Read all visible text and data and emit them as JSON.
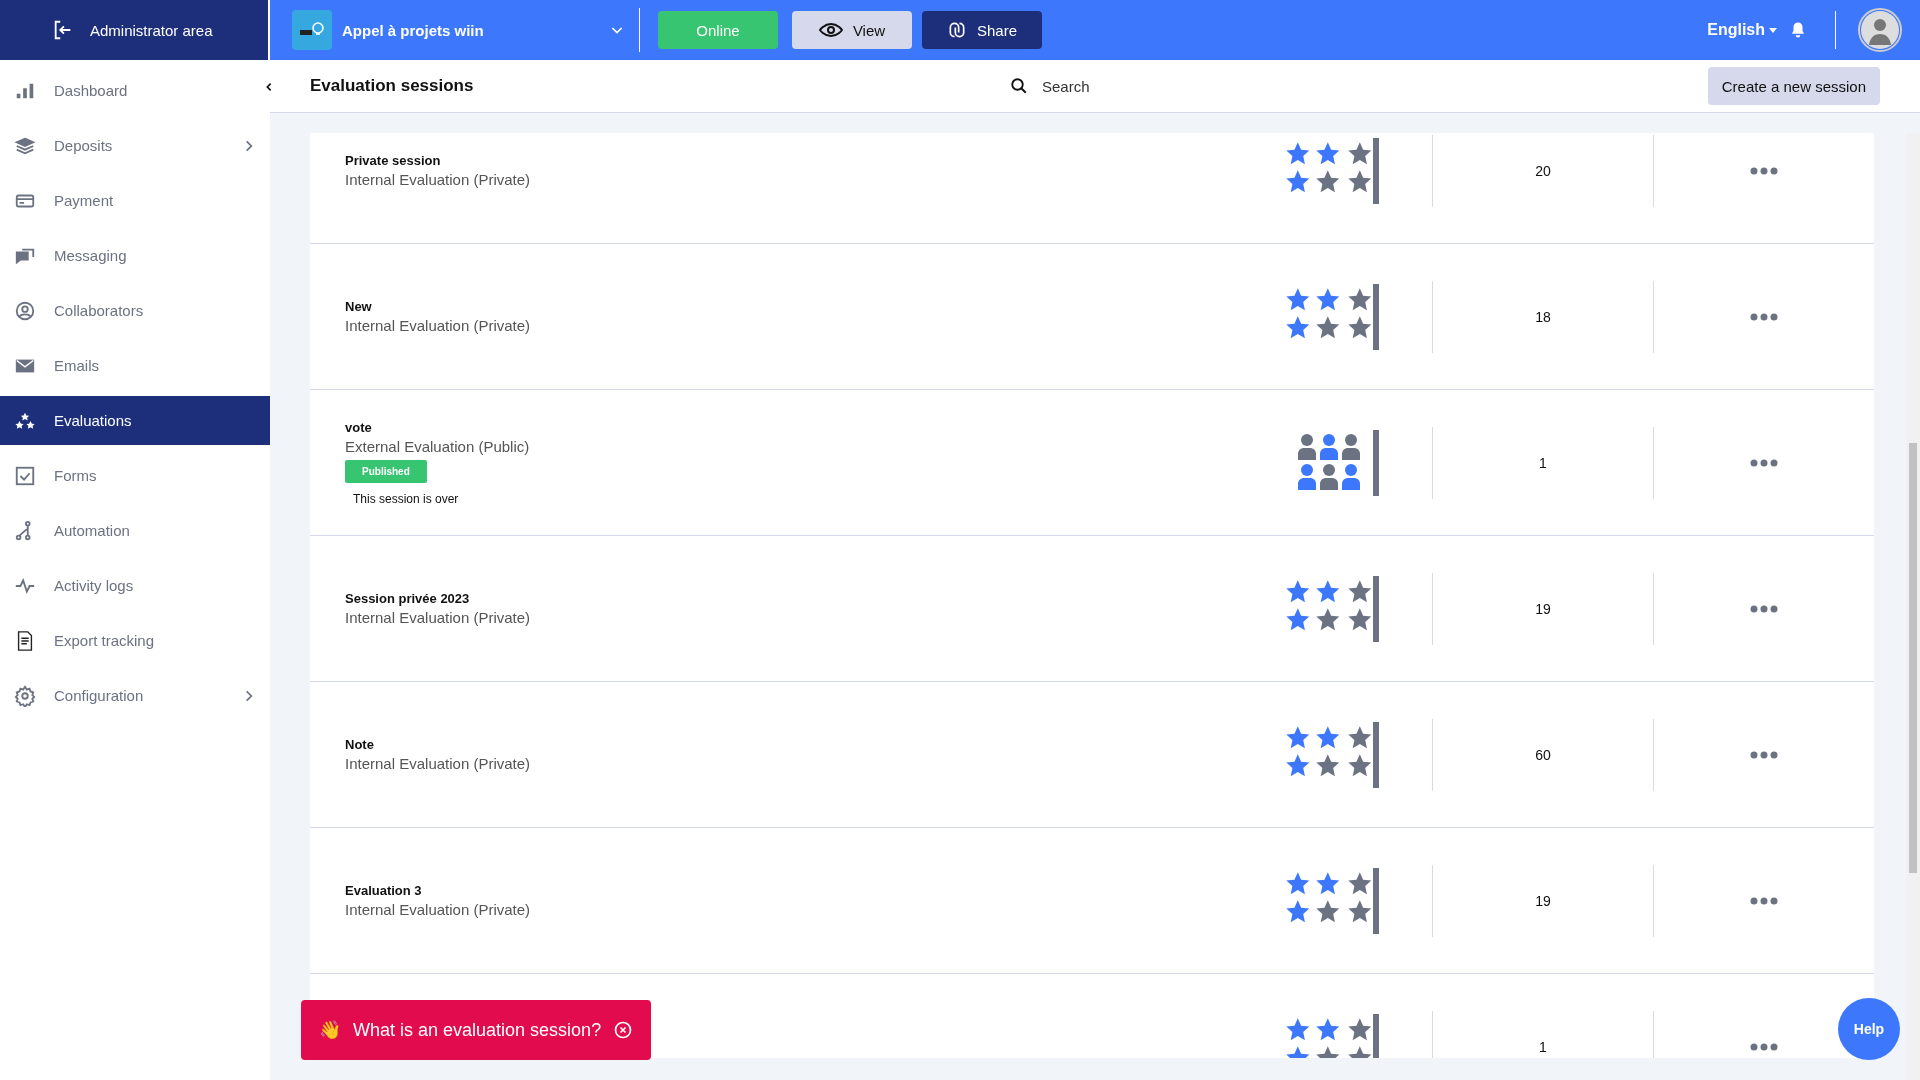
{
  "topbar": {
    "admin_label": "Administrator area",
    "project": "Appel à projets wiin",
    "status_button": "Online",
    "view_button": "View",
    "share_button": "Share",
    "language": "English"
  },
  "sidebar": {
    "items": [
      {
        "label": "Dashboard",
        "selected": false,
        "has_submenu": false
      },
      {
        "label": "Deposits",
        "selected": false,
        "has_submenu": true
      },
      {
        "label": "Payment",
        "selected": false,
        "has_submenu": false
      },
      {
        "label": "Messaging",
        "selected": false,
        "has_submenu": false
      },
      {
        "label": "Collaborators",
        "selected": false,
        "has_submenu": false
      },
      {
        "label": "Emails",
        "selected": false,
        "has_submenu": false
      },
      {
        "label": "Evaluations",
        "selected": true,
        "has_submenu": false
      },
      {
        "label": "Forms",
        "selected": false,
        "has_submenu": false
      },
      {
        "label": "Automation",
        "selected": false,
        "has_submenu": false
      },
      {
        "label": "Activity logs",
        "selected": false,
        "has_submenu": false
      },
      {
        "label": "Export tracking",
        "selected": false,
        "has_submenu": false
      },
      {
        "label": "Configuration",
        "selected": false,
        "has_submenu": true
      }
    ]
  },
  "header": {
    "title": "Evaluation sessions",
    "search_placeholder": "Search",
    "create_button": "Create a new session"
  },
  "sessions": [
    {
      "title": "Private session",
      "type": "Internal Evaluation (Private)",
      "kind": "stars",
      "count": "20"
    },
    {
      "title": "New",
      "type": "Internal Evaluation (Private)",
      "kind": "stars",
      "count": "18"
    },
    {
      "title": "vote",
      "type": "External Evaluation (Public)",
      "kind": "people",
      "badge": "Published",
      "note": "This session is over",
      "count": "1"
    },
    {
      "title": "Session privée 2023",
      "type": "Internal Evaluation (Private)",
      "kind": "stars",
      "count": "19"
    },
    {
      "title": "Note",
      "type": "Internal Evaluation (Private)",
      "kind": "stars",
      "count": "60"
    },
    {
      "title": "Evaluation 3",
      "type": "Internal Evaluation (Private)",
      "kind": "stars",
      "count": "19"
    },
    {
      "kind": "stars",
      "count": "1"
    }
  ],
  "toast": {
    "emoji": "👋",
    "text": "What is an evaluation session?"
  },
  "help_button": "Help"
}
